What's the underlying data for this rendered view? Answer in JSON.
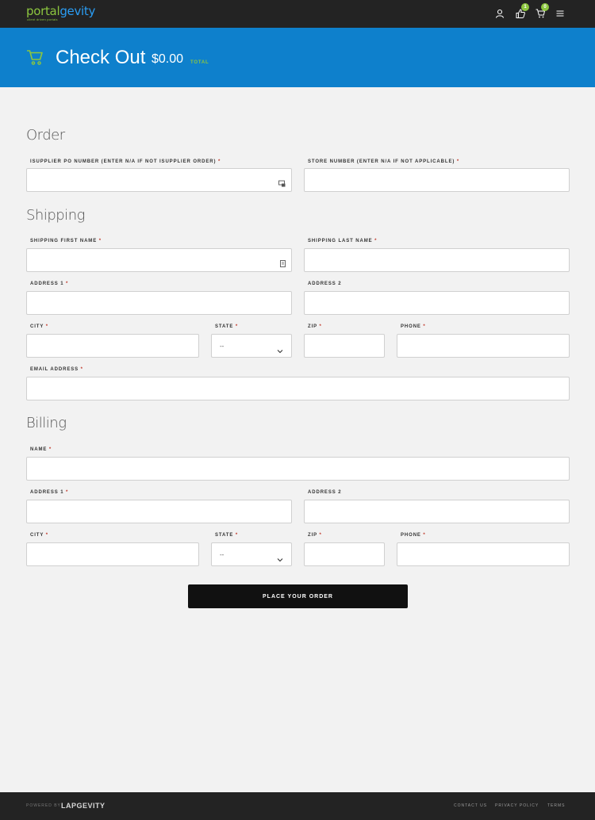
{
  "brand": {
    "logo_part1": "portal",
    "logo_part2": "gevity",
    "tagline": "client driven portals"
  },
  "nav": {
    "likes_count": "1",
    "cart_count": "0"
  },
  "header": {
    "title": "Check Out",
    "amount": "$0.00",
    "total_label": "TOTAL"
  },
  "order": {
    "heading": "Order",
    "po_label": "ISUPPLIER PO NUMBER (ENTER N/A IF NOT ISUPPLIER ORDER)",
    "store_label": "STORE NUMBER (ENTER N/A IF NOT APPLICABLE)"
  },
  "shipping": {
    "heading": "Shipping",
    "first_name_label": "SHIPPING FIRST NAME",
    "last_name_label": "SHIPPING LAST NAME",
    "address1_label": "ADDRESS 1",
    "address2_label": "ADDRESS 2",
    "city_label": "CITY",
    "state_label": "STATE",
    "state_value": "--",
    "zip_label": "ZIP",
    "phone_label": "PHONE",
    "email_label": "EMAIL ADDRESS"
  },
  "billing": {
    "heading": "Billing",
    "name_label": "NAME",
    "address1_label": "ADDRESS 1",
    "address2_label": "ADDRESS 2",
    "city_label": "CITY",
    "state_label": "STATE",
    "state_value": "--",
    "zip_label": "ZIP",
    "phone_label": "PHONE"
  },
  "required_mark": "*",
  "submit_label": "PLACE YOUR ORDER",
  "footer": {
    "powered_by": "POWERED BY",
    "brand": "LAPGEVITY",
    "contact": "CONTACT US",
    "privacy": "PRIVACY POLICY",
    "terms": "TERMS"
  },
  "colors": {
    "topbar": "#232323",
    "header_band": "#0e80cc",
    "accent_green": "#8cc63f",
    "button": "#111111"
  },
  "icons": [
    "user-icon",
    "thumbs-up-icon",
    "cart-icon",
    "menu-icon",
    "hero-cart-icon",
    "autofill-icon",
    "contact-card-icon",
    "chevron-down-icon"
  ]
}
